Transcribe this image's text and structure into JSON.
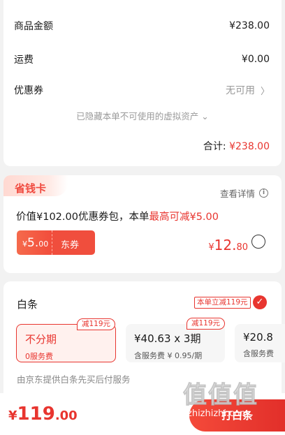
{
  "summary": {
    "goods_label": "商品金额",
    "goods_value": "¥238.00",
    "shipping_label": "运费",
    "shipping_value": "¥0.00",
    "coupon_label": "优惠券",
    "coupon_value": "无可用",
    "hidden_note": "已隐藏本单不可使用的虚拟资产",
    "total_label": "合计:",
    "total_value": "¥238.00"
  },
  "saver_card": {
    "badge": "省钱卡",
    "detail_label": "查看详情",
    "desc_prefix": "价值¥102.00优惠券包，本单",
    "desc_highlight": "最高可减¥5.00",
    "coupon_currency": "¥",
    "coupon_int": "5.",
    "coupon_dec": "00",
    "coupon_tag": "东券",
    "price_currency": "¥",
    "price_int": "12.",
    "price_dec": "80"
  },
  "baitiao": {
    "title": "白条",
    "promo": "本单立减119元",
    "plans": [
      {
        "main": "不分期",
        "sub": "0服务费",
        "badge": "减119元",
        "selected": true
      },
      {
        "main": "¥40.63 x 3期",
        "sub": "含服务费 ¥ 0.95/期",
        "badge": "减119元",
        "selected": false
      },
      {
        "main": "¥20.8",
        "sub": "含服务费",
        "badge": "",
        "selected": false
      }
    ],
    "note": "由京东提供白条先买后付服务"
  },
  "bottom": {
    "currency": "¥",
    "amount_int": "119",
    "amount_dec": ".00",
    "pay_button": "打白条"
  },
  "watermark": {
    "logo": "值值值",
    "url": "zhizhizhi.com"
  },
  "colors": {
    "accent": "#e8352f",
    "background": "#f2f2f2"
  }
}
